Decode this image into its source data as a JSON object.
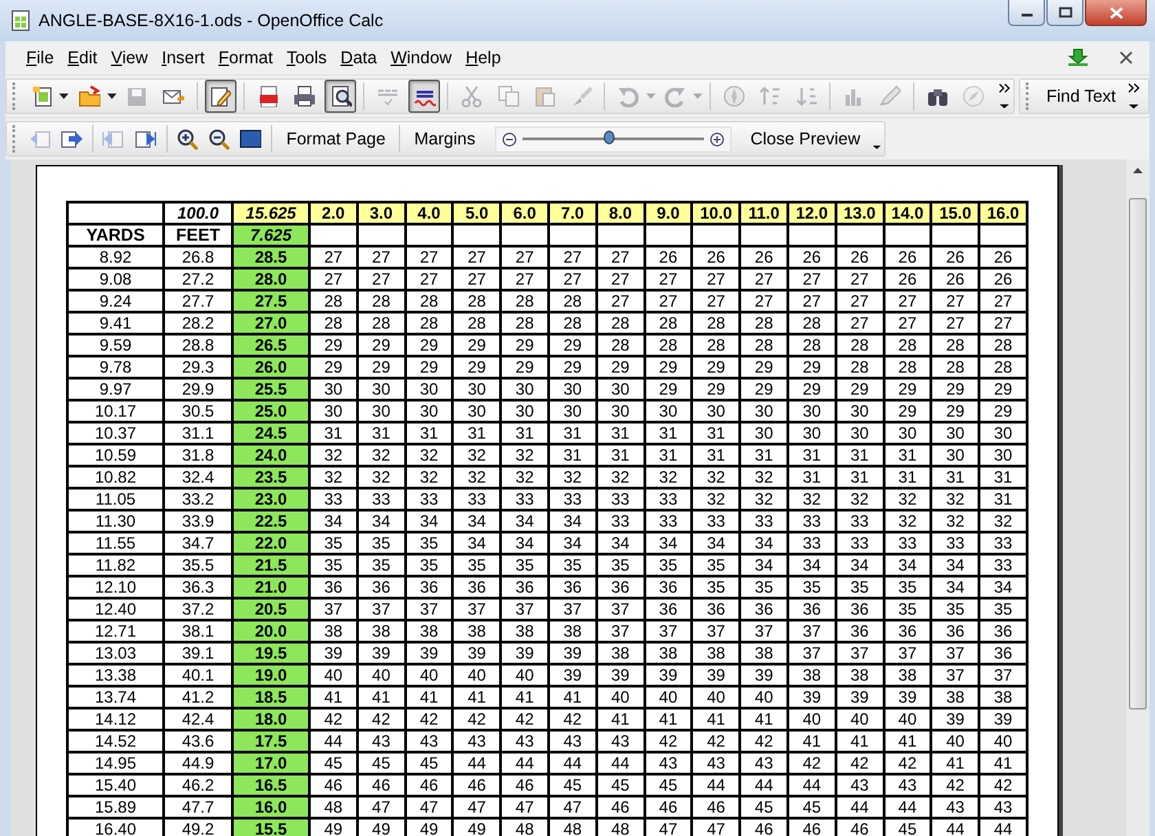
{
  "window": {
    "title": "ANGLE-BASE-8X16-1.ods - OpenOffice Calc"
  },
  "menu": [
    "File",
    "Edit",
    "View",
    "Insert",
    "Format",
    "Tools",
    "Data",
    "Window",
    "Help"
  ],
  "toolbar": [
    {
      "kind": "new",
      "disabled": false,
      "pressed": false
    },
    {
      "kind": "open",
      "disabled": false,
      "pressed": false
    },
    {
      "kind": "save",
      "disabled": true,
      "pressed": false
    },
    {
      "kind": "email",
      "disabled": false,
      "pressed": false
    },
    {
      "kind": "edit",
      "disabled": false,
      "pressed": true
    },
    {
      "kind": "pdf",
      "disabled": false,
      "pressed": false
    },
    {
      "kind": "print",
      "disabled": false,
      "pressed": false
    },
    {
      "kind": "preview",
      "disabled": false,
      "pressed": true
    },
    {
      "kind": "spellcheck",
      "disabled": true,
      "pressed": false
    },
    {
      "kind": "autospell",
      "disabled": false,
      "pressed": true
    },
    {
      "kind": "cut",
      "disabled": true,
      "pressed": false
    },
    {
      "kind": "copy",
      "disabled": true,
      "pressed": false
    },
    {
      "kind": "paste",
      "disabled": true,
      "pressed": false
    },
    {
      "kind": "brush",
      "disabled": true,
      "pressed": false
    },
    {
      "kind": "undo",
      "disabled": true,
      "pressed": false
    },
    {
      "kind": "redo",
      "disabled": true,
      "pressed": false
    },
    {
      "kind": "navigator",
      "disabled": true,
      "pressed": false
    },
    {
      "kind": "sort_asc",
      "disabled": true,
      "pressed": false
    },
    {
      "kind": "sort_desc",
      "disabled": true,
      "pressed": false
    },
    {
      "kind": "chart",
      "disabled": true,
      "pressed": false
    },
    {
      "kind": "draw",
      "disabled": true,
      "pressed": false
    },
    {
      "kind": "find",
      "disabled": false,
      "pressed": false
    },
    {
      "kind": "compass",
      "disabled": true,
      "pressed": false
    }
  ],
  "find_toolbar": {
    "label": "Find Text"
  },
  "preview_toolbar": {
    "nav": [
      {
        "kind": "prev",
        "disabled": true
      },
      {
        "kind": "next",
        "disabled": false
      },
      {
        "kind": "first",
        "disabled": true
      },
      {
        "kind": "last",
        "disabled": false
      },
      {
        "kind": "zoom_in",
        "disabled": false
      },
      {
        "kind": "zoom_out",
        "disabled": false
      },
      {
        "kind": "fullscreen",
        "disabled": false
      }
    ],
    "format_page": "Format Page",
    "margins": "Margins",
    "zoom": {
      "level": 0.48
    },
    "close": "Close Preview"
  },
  "table": {
    "top_row": {
      "scale": "100.0",
      "base": "15.625",
      "angles": [
        "2.0",
        "3.0",
        "4.0",
        "5.0",
        "6.0",
        "7.0",
        "8.0",
        "9.0",
        "10.0",
        "11.0",
        "12.0",
        "13.0",
        "14.0",
        "15.0",
        "16.0"
      ]
    },
    "label_row": {
      "yards": "YARDS",
      "feet": "FEET",
      "base": "7.625"
    },
    "rows": [
      {
        "yards": "8.92",
        "feet": "26.8",
        "angle": "28.5",
        "values": [
          "27",
          "27",
          "27",
          "27",
          "27",
          "27",
          "27",
          "26",
          "26",
          "26",
          "26",
          "26",
          "26",
          "26",
          "26"
        ]
      },
      {
        "yards": "9.08",
        "feet": "27.2",
        "angle": "28.0",
        "values": [
          "27",
          "27",
          "27",
          "27",
          "27",
          "27",
          "27",
          "27",
          "27",
          "27",
          "27",
          "27",
          "26",
          "26",
          "26"
        ]
      },
      {
        "yards": "9.24",
        "feet": "27.7",
        "angle": "27.5",
        "values": [
          "28",
          "28",
          "28",
          "28",
          "28",
          "28",
          "27",
          "27",
          "27",
          "27",
          "27",
          "27",
          "27",
          "27",
          "27"
        ]
      },
      {
        "yards": "9.41",
        "feet": "28.2",
        "angle": "27.0",
        "values": [
          "28",
          "28",
          "28",
          "28",
          "28",
          "28",
          "28",
          "28",
          "28",
          "28",
          "28",
          "27",
          "27",
          "27",
          "27"
        ]
      },
      {
        "yards": "9.59",
        "feet": "28.8",
        "angle": "26.5",
        "values": [
          "29",
          "29",
          "29",
          "29",
          "29",
          "29",
          "28",
          "28",
          "28",
          "28",
          "28",
          "28",
          "28",
          "28",
          "28"
        ]
      },
      {
        "yards": "9.78",
        "feet": "29.3",
        "angle": "26.0",
        "values": [
          "29",
          "29",
          "29",
          "29",
          "29",
          "29",
          "29",
          "29",
          "29",
          "29",
          "29",
          "28",
          "28",
          "28",
          "28"
        ]
      },
      {
        "yards": "9.97",
        "feet": "29.9",
        "angle": "25.5",
        "values": [
          "30",
          "30",
          "30",
          "30",
          "30",
          "30",
          "30",
          "29",
          "29",
          "29",
          "29",
          "29",
          "29",
          "29",
          "29"
        ]
      },
      {
        "yards": "10.17",
        "feet": "30.5",
        "angle": "25.0",
        "values": [
          "30",
          "30",
          "30",
          "30",
          "30",
          "30",
          "30",
          "30",
          "30",
          "30",
          "30",
          "30",
          "29",
          "29",
          "29"
        ]
      },
      {
        "yards": "10.37",
        "feet": "31.1",
        "angle": "24.5",
        "values": [
          "31",
          "31",
          "31",
          "31",
          "31",
          "31",
          "31",
          "31",
          "31",
          "30",
          "30",
          "30",
          "30",
          "30",
          "30"
        ]
      },
      {
        "yards": "10.59",
        "feet": "31.8",
        "angle": "24.0",
        "values": [
          "32",
          "32",
          "32",
          "32",
          "32",
          "31",
          "31",
          "31",
          "31",
          "31",
          "31",
          "31",
          "31",
          "30",
          "30"
        ]
      },
      {
        "yards": "10.82",
        "feet": "32.4",
        "angle": "23.5",
        "values": [
          "32",
          "32",
          "32",
          "32",
          "32",
          "32",
          "32",
          "32",
          "32",
          "32",
          "31",
          "31",
          "31",
          "31",
          "31"
        ]
      },
      {
        "yards": "11.05",
        "feet": "33.2",
        "angle": "23.0",
        "values": [
          "33",
          "33",
          "33",
          "33",
          "33",
          "33",
          "33",
          "33",
          "32",
          "32",
          "32",
          "32",
          "32",
          "32",
          "31"
        ]
      },
      {
        "yards": "11.30",
        "feet": "33.9",
        "angle": "22.5",
        "values": [
          "34",
          "34",
          "34",
          "34",
          "34",
          "34",
          "33",
          "33",
          "33",
          "33",
          "33",
          "33",
          "32",
          "32",
          "32"
        ]
      },
      {
        "yards": "11.55",
        "feet": "34.7",
        "angle": "22.0",
        "values": [
          "35",
          "35",
          "35",
          "34",
          "34",
          "34",
          "34",
          "34",
          "34",
          "34",
          "33",
          "33",
          "33",
          "33",
          "33"
        ]
      },
      {
        "yards": "11.82",
        "feet": "35.5",
        "angle": "21.5",
        "values": [
          "35",
          "35",
          "35",
          "35",
          "35",
          "35",
          "35",
          "35",
          "35",
          "34",
          "34",
          "34",
          "34",
          "34",
          "33"
        ]
      },
      {
        "yards": "12.10",
        "feet": "36.3",
        "angle": "21.0",
        "values": [
          "36",
          "36",
          "36",
          "36",
          "36",
          "36",
          "36",
          "36",
          "35",
          "35",
          "35",
          "35",
          "35",
          "34",
          "34"
        ]
      },
      {
        "yards": "12.40",
        "feet": "37.2",
        "angle": "20.5",
        "values": [
          "37",
          "37",
          "37",
          "37",
          "37",
          "37",
          "37",
          "36",
          "36",
          "36",
          "36",
          "36",
          "35",
          "35",
          "35"
        ]
      },
      {
        "yards": "12.71",
        "feet": "38.1",
        "angle": "20.0",
        "values": [
          "38",
          "38",
          "38",
          "38",
          "38",
          "38",
          "37",
          "37",
          "37",
          "37",
          "37",
          "36",
          "36",
          "36",
          "36"
        ]
      },
      {
        "yards": "13.03",
        "feet": "39.1",
        "angle": "19.5",
        "values": [
          "39",
          "39",
          "39",
          "39",
          "39",
          "39",
          "38",
          "38",
          "38",
          "38",
          "37",
          "37",
          "37",
          "37",
          "36"
        ]
      },
      {
        "yards": "13.38",
        "feet": "40.1",
        "angle": "19.0",
        "values": [
          "40",
          "40",
          "40",
          "40",
          "40",
          "39",
          "39",
          "39",
          "39",
          "39",
          "38",
          "38",
          "38",
          "37",
          "37"
        ]
      },
      {
        "yards": "13.74",
        "feet": "41.2",
        "angle": "18.5",
        "values": [
          "41",
          "41",
          "41",
          "41",
          "41",
          "41",
          "40",
          "40",
          "40",
          "40",
          "39",
          "39",
          "39",
          "38",
          "38"
        ]
      },
      {
        "yards": "14.12",
        "feet": "42.4",
        "angle": "18.0",
        "values": [
          "42",
          "42",
          "42",
          "42",
          "42",
          "42",
          "41",
          "41",
          "41",
          "41",
          "40",
          "40",
          "40",
          "39",
          "39"
        ]
      },
      {
        "yards": "14.52",
        "feet": "43.6",
        "angle": "17.5",
        "values": [
          "44",
          "43",
          "43",
          "43",
          "43",
          "43",
          "43",
          "42",
          "42",
          "42",
          "41",
          "41",
          "41",
          "40",
          "40"
        ]
      },
      {
        "yards": "14.95",
        "feet": "44.9",
        "angle": "17.0",
        "values": [
          "45",
          "45",
          "45",
          "44",
          "44",
          "44",
          "44",
          "43",
          "43",
          "43",
          "42",
          "42",
          "42",
          "41",
          "41"
        ]
      },
      {
        "yards": "15.40",
        "feet": "46.2",
        "angle": "16.5",
        "values": [
          "46",
          "46",
          "46",
          "46",
          "46",
          "45",
          "45",
          "45",
          "44",
          "44",
          "44",
          "43",
          "43",
          "42",
          "42"
        ]
      },
      {
        "yards": "15.89",
        "feet": "47.7",
        "angle": "16.0",
        "values": [
          "48",
          "47",
          "47",
          "47",
          "47",
          "47",
          "46",
          "46",
          "46",
          "45",
          "45",
          "44",
          "44",
          "43",
          "43"
        ]
      },
      {
        "yards": "16.40",
        "feet": "49.2",
        "angle": "15.5",
        "values": [
          "49",
          "49",
          "49",
          "49",
          "48",
          "48",
          "48",
          "47",
          "47",
          "46",
          "46",
          "46",
          "45",
          "44",
          "44"
        ]
      }
    ]
  }
}
